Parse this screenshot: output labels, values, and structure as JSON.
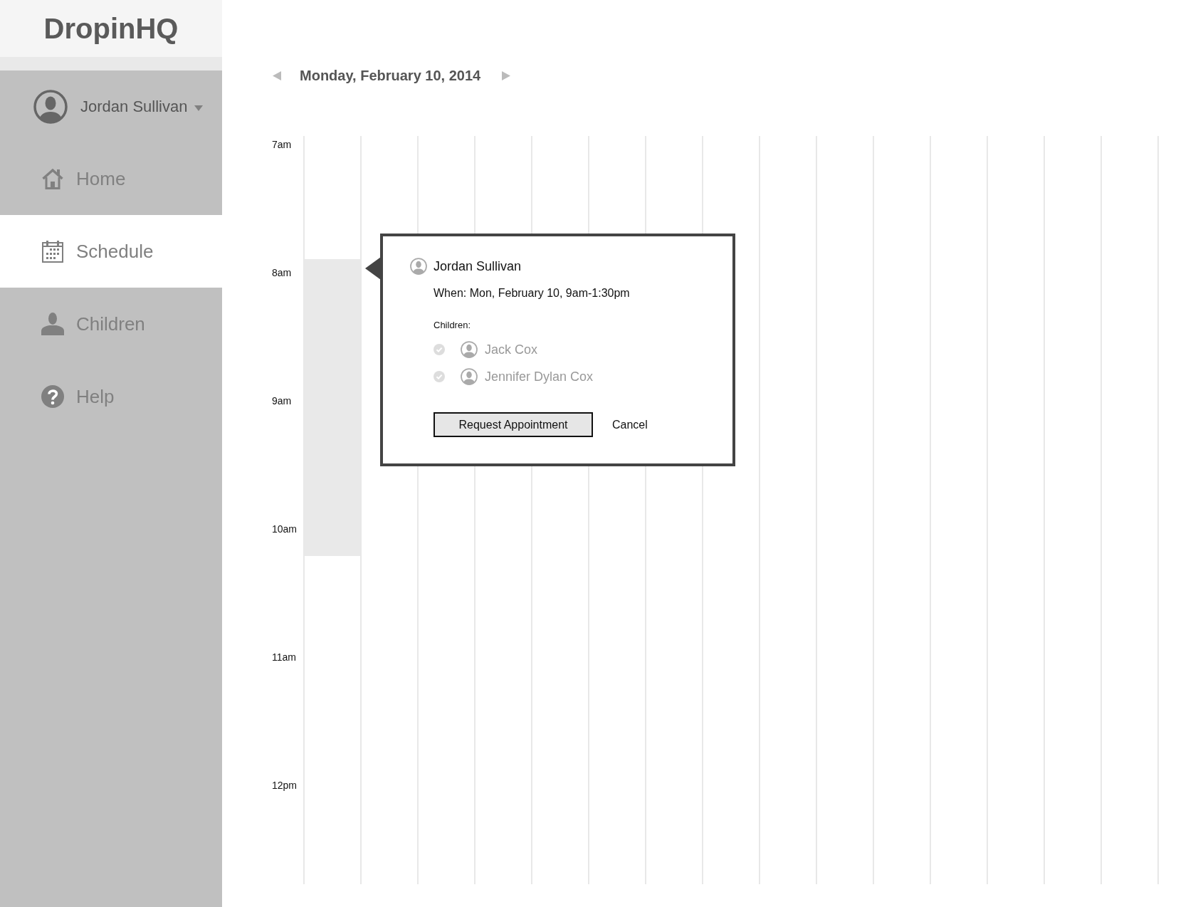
{
  "app": {
    "logo": "DropinHQ"
  },
  "user_menu": {
    "name": "Jordan Sullivan"
  },
  "sidebar": {
    "items": [
      {
        "kind": "home",
        "label": "Home",
        "selected": false
      },
      {
        "kind": "calendar",
        "label": "Schedule",
        "selected": true
      },
      {
        "kind": "person",
        "label": "Children",
        "selected": false
      },
      {
        "kind": "help",
        "label": "Help",
        "selected": false
      }
    ]
  },
  "date_nav": {
    "date": "Monday, February 10, 2014"
  },
  "schedule": {
    "time_labels": [
      "7am",
      "8am",
      "9am",
      "10am",
      "11am",
      "12pm"
    ]
  },
  "popover": {
    "name": "Jordan Sullivan",
    "when": "When: Mon, February 10, 9am-1:30pm",
    "children_label": "Children:",
    "children": [
      {
        "name": "Jack Cox",
        "selected": false
      },
      {
        "name": "Jennifer Dylan Cox",
        "selected": false
      }
    ],
    "buttons": [
      {
        "kind": "primary",
        "label": "Request Appointment"
      },
      {
        "kind": "link",
        "label": "Cancel"
      }
    ]
  }
}
